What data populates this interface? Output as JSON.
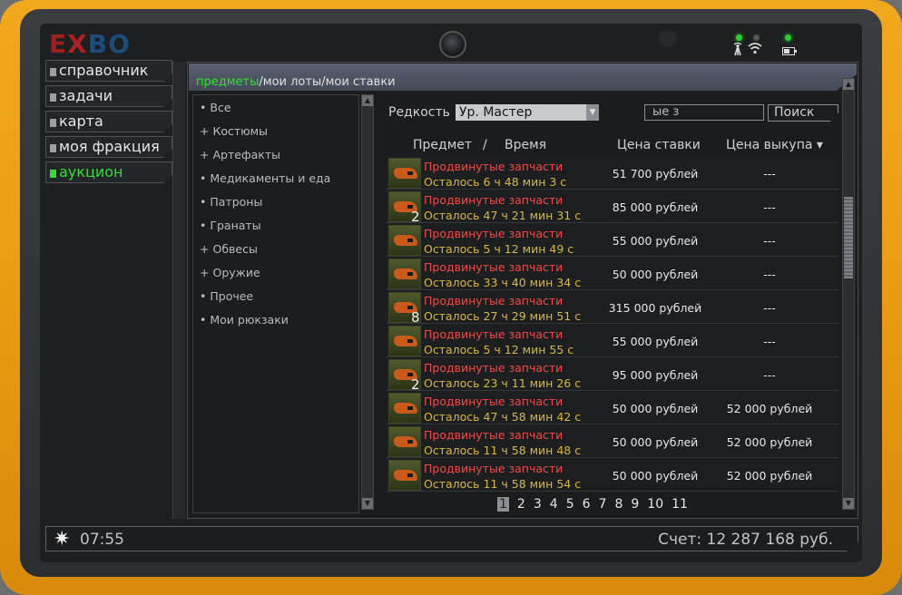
{
  "logo": {
    "part1": "E",
    "part2": "X",
    "part3": "BO"
  },
  "menu": [
    {
      "label": "справочник",
      "active": false
    },
    {
      "label": "задачи",
      "active": false
    },
    {
      "label": "карта",
      "active": false
    },
    {
      "label": "моя фракция",
      "active": false
    },
    {
      "label": "аукцион",
      "active": true
    }
  ],
  "tabs": {
    "items": "предметы",
    "lots": "мои лоты",
    "bids": "мои ставки",
    "sep": "/"
  },
  "categories": [
    {
      "mark": "•",
      "label": "Все"
    },
    {
      "mark": "+",
      "label": "Костюмы"
    },
    {
      "mark": "+",
      "label": "Артефакты"
    },
    {
      "mark": "•",
      "label": "Медикаменты и еда"
    },
    {
      "mark": "•",
      "label": "Патроны"
    },
    {
      "mark": "•",
      "label": "Гранаты"
    },
    {
      "mark": "+",
      "label": "Обвесы"
    },
    {
      "mark": "+",
      "label": "Оружие"
    },
    {
      "mark": "•",
      "label": "Прочее"
    },
    {
      "mark": "•",
      "label": "Мои рюкзаки"
    }
  ],
  "filter": {
    "rarity_label": "Редкость",
    "rarity_value": "Ур. Мастер",
    "search_value": "ые з",
    "search_button": "Поиск"
  },
  "columns": {
    "item": "Предмет",
    "slash": "/",
    "time": "Время",
    "bid": "Цена ставки",
    "buyout": "Цена выкупа ▾"
  },
  "rows": [
    {
      "name": "Продвинутые запчасти",
      "time": "Осталось 6 ч 48 мин 3 с",
      "qty": "",
      "bid": "51 700 рублей",
      "buyout": "---"
    },
    {
      "name": "Продвинутые запчасти",
      "time": "Осталось 47 ч 21 мин 31 с",
      "qty": "2",
      "bid": "85 000 рублей",
      "buyout": "---"
    },
    {
      "name": "Продвинутые запчасти",
      "time": "Осталось 5 ч 12 мин 49 с",
      "qty": "",
      "bid": "55 000 рублей",
      "buyout": "---"
    },
    {
      "name": "Продвинутые запчасти",
      "time": "Осталось 33 ч 40 мин 34 с",
      "qty": "",
      "bid": "50 000 рублей",
      "buyout": "---"
    },
    {
      "name": "Продвинутые запчасти",
      "time": "Осталось 27 ч 29 мин 51 с",
      "qty": "8",
      "bid": "315 000 рублей",
      "buyout": "---"
    },
    {
      "name": "Продвинутые запчасти",
      "time": "Осталось 5 ч 12 мин 55 с",
      "qty": "",
      "bid": "55 000 рублей",
      "buyout": "---"
    },
    {
      "name": "Продвинутые запчасти",
      "time": "Осталось 23 ч 11 мин 26 с",
      "qty": "2",
      "bid": "95 000 рублей",
      "buyout": "---"
    },
    {
      "name": "Продвинутые запчасти",
      "time": "Осталось 47 ч 58 мин 42 с",
      "qty": "",
      "bid": "50 000 рублей",
      "buyout": "52 000 рублей"
    },
    {
      "name": "Продвинутые запчасти",
      "time": "Осталось 11 ч 58 мин 48 с",
      "qty": "",
      "bid": "50 000 рублей",
      "buyout": "52 000 рублей"
    },
    {
      "name": "Продвинутые запчасти",
      "time": "Осталось 11 ч 58 мин 54 с",
      "qty": "",
      "bid": "50 000 рублей",
      "buyout": "52 000 рублей"
    }
  ],
  "pages": [
    "1",
    "2",
    "3",
    "4",
    "5",
    "6",
    "7",
    "8",
    "9",
    "10",
    "11"
  ],
  "current_page": "1",
  "status": {
    "time": "07:55",
    "account": "Счет: 12 287 168 руб."
  },
  "colors": {
    "accent_green": "#2fe030",
    "item_name": "#ef4a4a",
    "time_text": "#d8b93a",
    "device_frame": "#f2a81c"
  }
}
